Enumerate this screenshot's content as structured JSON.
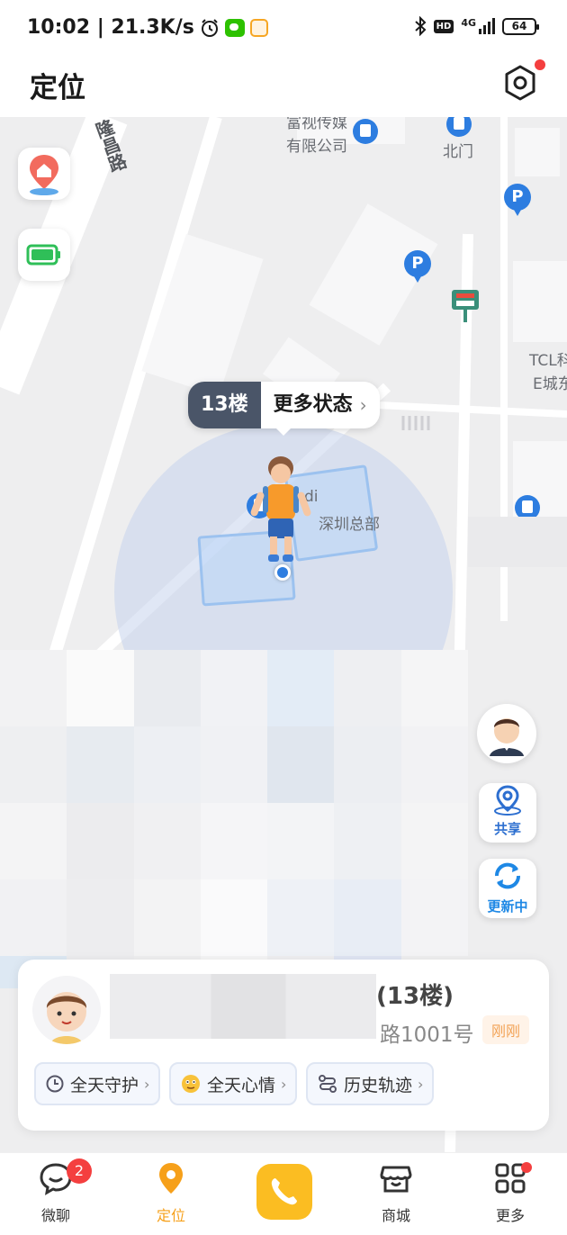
{
  "status_bar": {
    "time_speed": "10:02 | 21.3K/s",
    "network": "4G",
    "hd": "HD",
    "battery": "64"
  },
  "header": {
    "title": "定位"
  },
  "map": {
    "labels": {
      "road_name": "隆昌路",
      "poi_company": "有限公司",
      "poi_company_top": "富视传媒",
      "north_gate": "北门",
      "tcl": "TCL科",
      "e_city": "E城东",
      "building_di": "di",
      "building_hq": "深圳总部"
    },
    "floor_tag": "13楼",
    "more_status": "更多状态",
    "buttons": {
      "share": "共享",
      "updating": "更新中"
    }
  },
  "card": {
    "address_line1": "(13楼)",
    "address_line2": "路1001号",
    "time": "刚刚",
    "chips": [
      {
        "label": "全天守护",
        "icon": "clock-icon"
      },
      {
        "label": "全天心情",
        "icon": "emoji-icon"
      },
      {
        "label": "历史轨迹",
        "icon": "track-icon"
      }
    ]
  },
  "nav": {
    "items": [
      {
        "label": "微聊",
        "badge": "2"
      },
      {
        "label": "定位"
      },
      {
        "label": "商城"
      },
      {
        "label": "更多"
      }
    ]
  },
  "colors": {
    "accent": "#f6a01a",
    "map_blue": "#2d7de0",
    "badge_red": "#f43f3f",
    "call_yellow": "#fbbd22"
  }
}
